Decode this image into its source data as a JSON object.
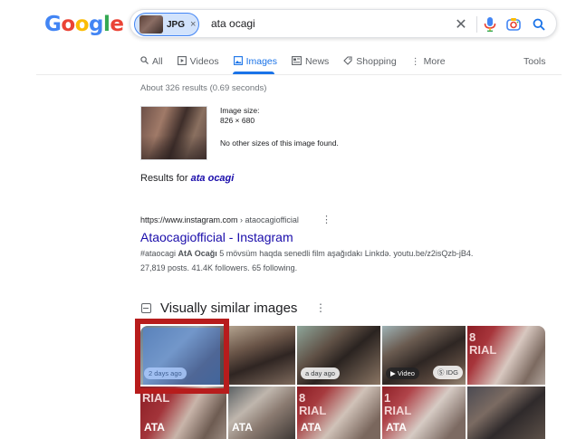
{
  "logo": {
    "letters": [
      "G",
      "o",
      "o",
      "g",
      "l",
      "e"
    ]
  },
  "search": {
    "chip_label": "JPG",
    "chip_close": "×",
    "query": "ata ocagi",
    "clear_glyph": "✕"
  },
  "tabs": [
    {
      "label": "All",
      "icon": "search-icon"
    },
    {
      "label": "Videos",
      "icon": "video-icon"
    },
    {
      "label": "Images",
      "icon": "image-icon",
      "active": true
    },
    {
      "label": "News",
      "icon": "news-icon"
    },
    {
      "label": "Shopping",
      "icon": "tag-icon"
    },
    {
      "label": "More",
      "icon": "more-vertical-icon"
    }
  ],
  "tools_label": "Tools",
  "stats": "About 326 results (0.69 seconds)",
  "image_info": {
    "size_label": "Image size:",
    "size_value": "826 × 680",
    "no_other": "No other sizes of this image found."
  },
  "results_for": {
    "prefix": "Results for",
    "query": "ata ocagi"
  },
  "result": {
    "url": "https://www.instagram.com",
    "path": " › ataocagiofficial",
    "title": "Ataocagiofficial - Instagram",
    "snippet1_pre": "#ataocagi ",
    "snippet1_bold": "AtA Ocağı",
    "snippet1_post": " 5 mövsüm haqda senedli film aşağıdakı Linkdə. youtu.be/z2isQzb-jB4.",
    "snippet2": "27,819 posts. 41.4K followers. 65 following."
  },
  "similar": {
    "title": "Visually similar images",
    "badges": {
      "first": "2 days ago",
      "third": "a day ago",
      "fifth": "Video",
      "fifth_small": "Ⓢ IDG"
    },
    "overlays": {
      "ata": "ATA",
      "red_top": "8\nRIAL",
      "red_side": "RIAL"
    }
  },
  "colors": {
    "accent": "#1a73e8",
    "link": "#1a0dab",
    "highlight_border": "#b71c1c"
  }
}
